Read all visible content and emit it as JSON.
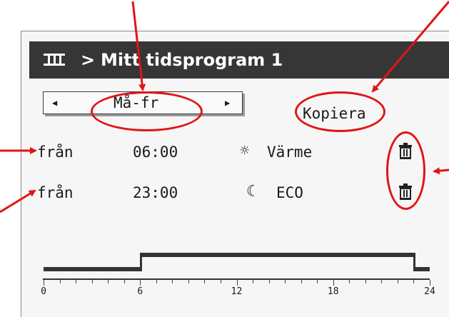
{
  "header": {
    "menu_icon": "menu-icon",
    "separator": ">",
    "title": "Mitt tidsprogram 1"
  },
  "day_selector": {
    "value": "Må-fr",
    "prev_icon": "triangle-left-icon",
    "next_icon": "triangle-right-icon"
  },
  "copy_button": {
    "label": "Kopiera"
  },
  "switch_points": [
    {
      "from_label": "från",
      "time": "06:00",
      "mode_icon": "sun-icon",
      "mode_label": "Värme",
      "delete_icon": "trash-icon"
    },
    {
      "from_label": "från",
      "time": "23:00",
      "mode_icon": "moon-icon",
      "mode_label": "ECO",
      "delete_icon": "trash-icon"
    }
  ],
  "timeline": {
    "tick_labels": [
      "0",
      "6",
      "12",
      "18",
      "24"
    ],
    "segments": [
      {
        "from": 0,
        "to": 6,
        "mode": "ECO"
      },
      {
        "from": 6,
        "to": 23,
        "mode": "Värme"
      },
      {
        "from": 23,
        "to": 24,
        "mode": "ECO"
      }
    ]
  },
  "annotation_color": "#e21414"
}
